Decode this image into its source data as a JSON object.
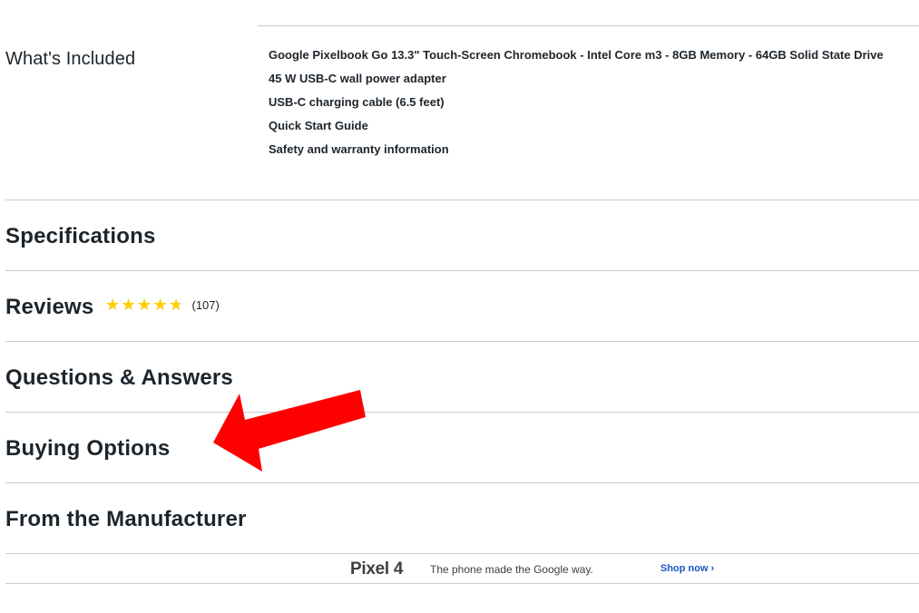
{
  "whats_included": {
    "label": "What's Included",
    "items": [
      "Google Pixelbook Go 13.3\" Touch-Screen Chromebook - Intel Core m3 - 8GB Memory - 64GB Solid State Drive",
      "45 W USB-C wall power adapter",
      "USB-C charging cable (6.5 feet)",
      "Quick Start Guide",
      "Safety and warranty information"
    ]
  },
  "sections": {
    "specifications": "Specifications",
    "reviews": "Reviews",
    "questions": "Questions & Answers",
    "buying": "Buying Options",
    "manufacturer": "From the Manufacturer"
  },
  "reviews": {
    "rating": 4.7,
    "max_rating": 5,
    "count": "(107)"
  },
  "banner": {
    "logo": "Pixel 4",
    "tagline": "The phone made the Google way.",
    "cta": "Shop now ›"
  },
  "colors": {
    "star": "#ffce00",
    "arrow": "#ff0000",
    "link": "#1a57c6"
  }
}
